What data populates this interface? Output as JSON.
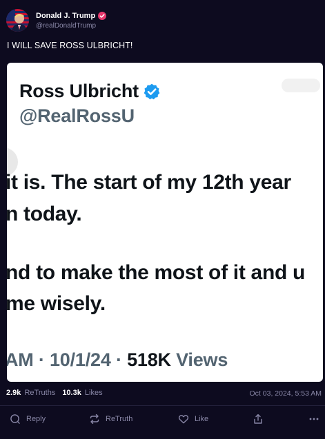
{
  "author": {
    "display_name": "Donald J. Trump",
    "handle": "@realDonaldTrump",
    "avatar_icon": "avatar-flag-portrait",
    "verified_icon": "verified-badge-icon",
    "badge_color": "#e6386c"
  },
  "post": {
    "text": "I WILL SAVE ROSS ULBRICHT!"
  },
  "embedded_tweet": {
    "name": "Ross Ulbricht",
    "handle": "@RealRossU",
    "verified_color": "#1d9bf0",
    "lines": [
      "it is. The start of my 12th year",
      "n today.",
      "nd to make the most of it and u",
      "me wisely."
    ],
    "meta_prefix": "AM · 10/1/24 · ",
    "views_count": "518K",
    "views_label": " Views"
  },
  "stats": {
    "retruths_count": "2.9k",
    "retruths_label": "ReTruths",
    "likes_count": "10.3k",
    "likes_label": "Likes",
    "timestamp": "Oct 03, 2024, 5:53 AM"
  },
  "actions": {
    "reply": "Reply",
    "retruth": "ReTruth",
    "like": "Like"
  },
  "colors": {
    "background": "#0d0b1f",
    "muted_text": "#8a88a8"
  }
}
